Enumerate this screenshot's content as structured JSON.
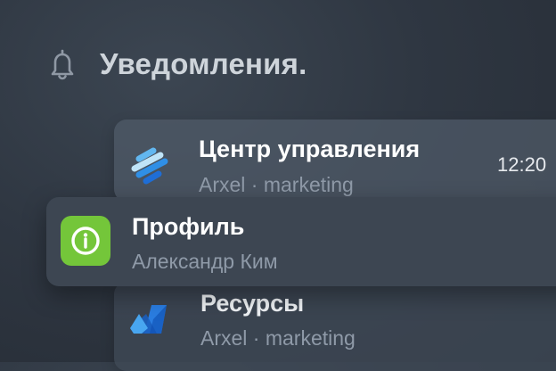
{
  "header": {
    "icon": "bell-icon",
    "title": "Уведомления."
  },
  "notifications": [
    {
      "app_icon": "arxel-stripes-icon",
      "title": "Центр управления",
      "subtitle": "Arxel · marketing",
      "time": "12:20"
    },
    {
      "app_icon": "info-icon",
      "icon_color": "#74c63a",
      "title": "Профиль",
      "subtitle": "Александр Ким"
    },
    {
      "app_icon": "azure-icon",
      "title": "Ресурсы",
      "subtitle": "Arxel · marketing"
    }
  ],
  "colors": {
    "background": "#2f3742",
    "card_front": "#3d4652",
    "subtitle": "#8f9aa8",
    "accent_blue": "#2f8fe6"
  }
}
